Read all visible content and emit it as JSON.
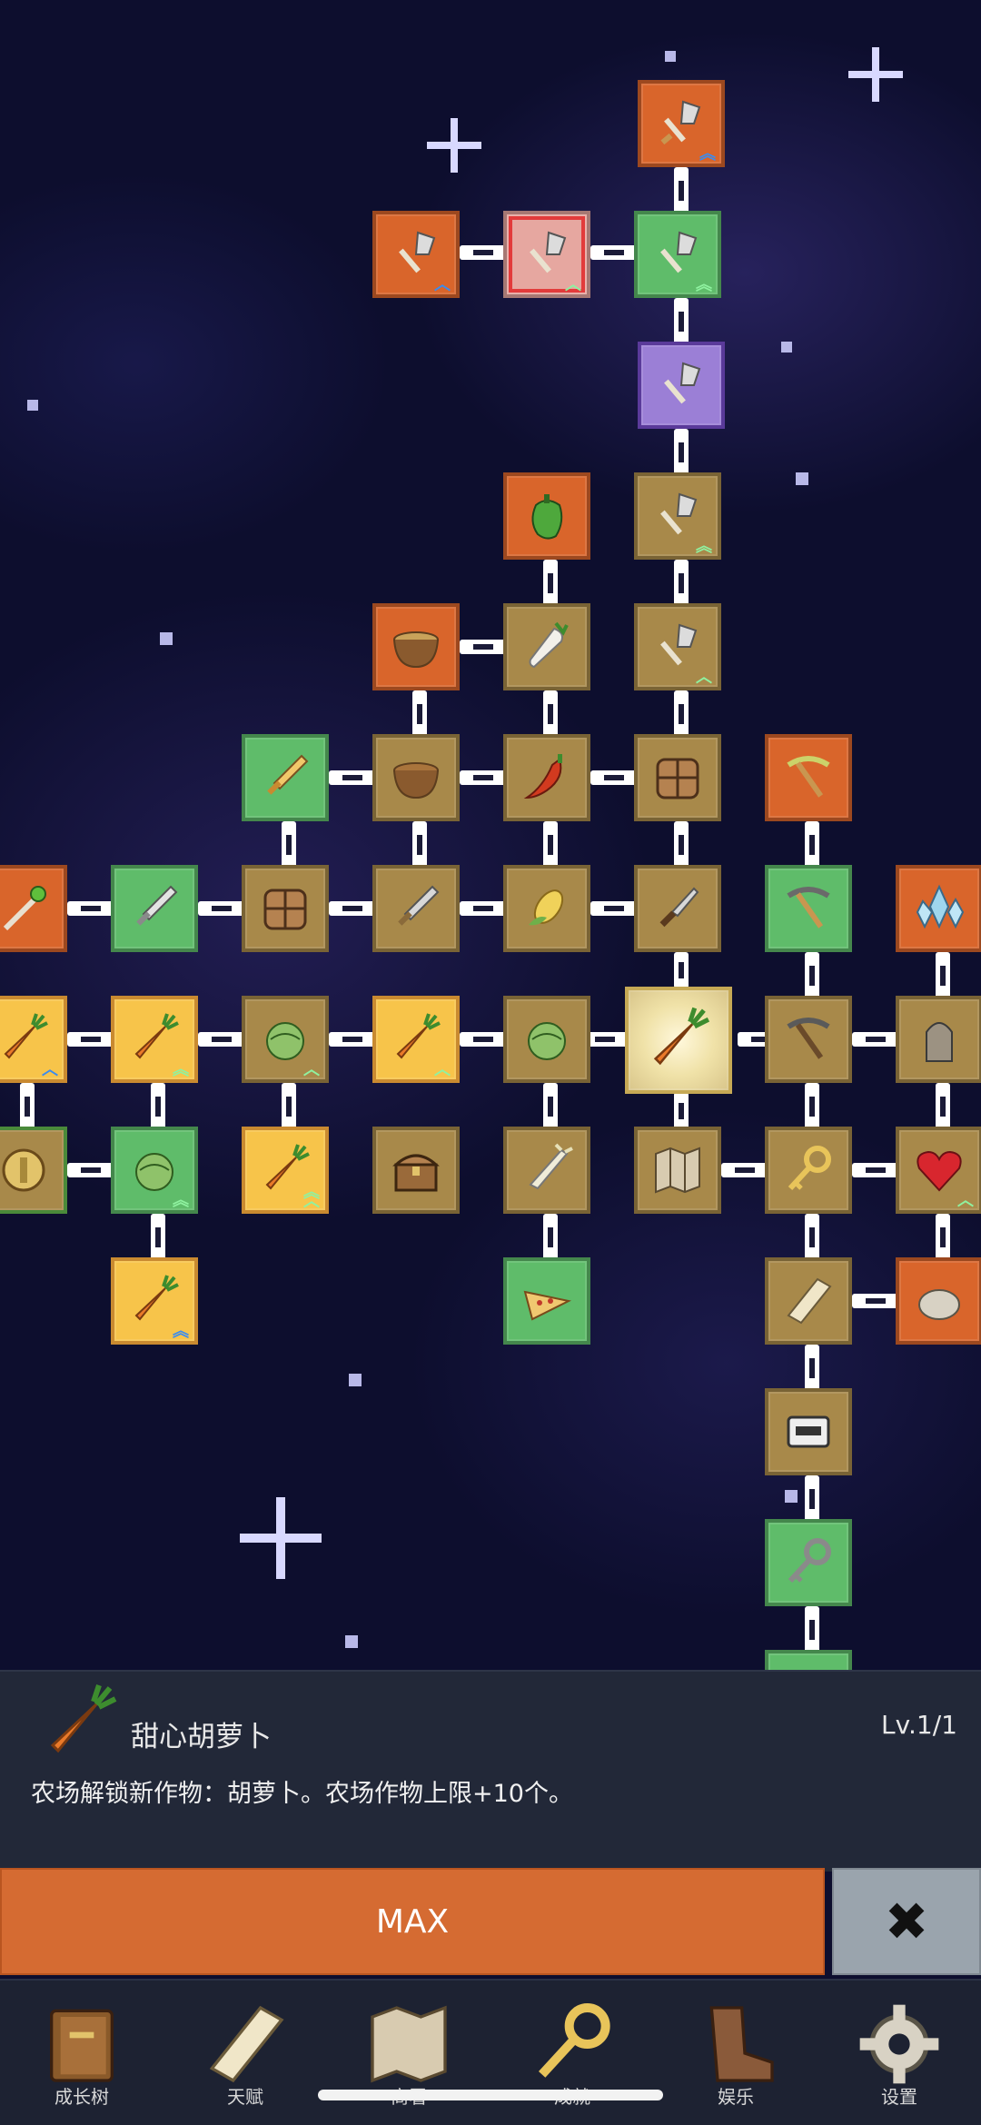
{
  "selected_skill": {
    "name": "甜心胡萝卜",
    "level": "Lv.1/1",
    "description": "农场解锁新作物：胡萝卜。农场作物上限+10个。",
    "icon": "carrot-icon"
  },
  "action_button": {
    "label": "MAX"
  },
  "close_button": {
    "icon": "close-icon",
    "glyph": "✖"
  },
  "nav": {
    "items": [
      {
        "label": "成长树",
        "icon": "book-icon"
      },
      {
        "label": "天赋",
        "icon": "scroll-icon"
      },
      {
        "label": "商署",
        "icon": "map-icon"
      },
      {
        "label": "成就",
        "icon": "key-icon"
      },
      {
        "label": "娱乐",
        "icon": "boot-icon"
      },
      {
        "label": "设置",
        "icon": "gear-icon"
      }
    ]
  },
  "tree_nodes": [
    {
      "icon": "shovel-icon",
      "color": "#d9652b",
      "upgrade": "double-blue"
    },
    {
      "icon": "shovel-icon",
      "color": "#d9652b",
      "upgrade": "single-blue"
    },
    {
      "icon": "shovel-icon",
      "color": "#5fbc6a",
      "upgrade": "single-green",
      "state": "selected-red"
    },
    {
      "icon": "shovel-icon",
      "color": "#5fbc6a",
      "upgrade": "double-green"
    },
    {
      "icon": "shovel-icon",
      "color": "#9b7fd6",
      "upgrade": "none"
    },
    {
      "icon": "pepper-icon",
      "color": "#d9652b"
    },
    {
      "icon": "shovel-icon",
      "color": "#a8894a",
      "upgrade": "double-green"
    },
    {
      "icon": "bowl-icon",
      "color": "#d9652b"
    },
    {
      "icon": "radish-icon",
      "color": "#a8894a"
    },
    {
      "icon": "shovel-icon",
      "color": "#a8894a",
      "upgrade": "single-green"
    },
    {
      "icon": "sword-icon",
      "color": "#5fbc6a"
    },
    {
      "icon": "bowl-icon",
      "color": "#a8894a"
    },
    {
      "icon": "chili-icon",
      "color": "#a8894a"
    },
    {
      "icon": "crate-icon",
      "color": "#a8894a"
    },
    {
      "icon": "pickaxe-icon",
      "color": "#d9652b"
    },
    {
      "icon": "wand-icon",
      "color": "#d9652b"
    },
    {
      "icon": "sword-icon",
      "color": "#5fbc6a"
    },
    {
      "icon": "crate-icon",
      "color": "#a8894a"
    },
    {
      "icon": "sword-icon",
      "color": "#a8894a"
    },
    {
      "icon": "corn-icon",
      "color": "#a8894a"
    },
    {
      "icon": "knife-icon",
      "color": "#a8894a"
    },
    {
      "icon": "pickaxe-icon",
      "color": "#5fbc6a"
    },
    {
      "icon": "crystal-icon",
      "color": "#d9652b"
    },
    {
      "icon": "carrot-icon",
      "color": "#f7c44a",
      "upgrade": "single-blue"
    },
    {
      "icon": "carrot-icon",
      "color": "#f7c44a",
      "upgrade": "double-green"
    },
    {
      "icon": "cabbage-icon",
      "color": "#a8894a",
      "upgrade": "single-green"
    },
    {
      "icon": "carrot-icon",
      "color": "#f7c44a",
      "upgrade": "single-green"
    },
    {
      "icon": "cabbage-icon",
      "color": "#a8894a"
    },
    {
      "icon": "carrot-icon",
      "color": "#f0e2a8",
      "state": "current"
    },
    {
      "icon": "pickaxe-icon",
      "color": "#a8894a"
    },
    {
      "icon": "statue-icon",
      "color": "#a8894a"
    },
    {
      "icon": "coin-icon",
      "color": "#a8894a"
    },
    {
      "icon": "cabbage-icon",
      "color": "#5fbc6a",
      "upgrade": "double-green"
    },
    {
      "icon": "carrot-icon",
      "color": "#f7c44a",
      "upgrade": "triple-green"
    },
    {
      "icon": "chest-icon",
      "color": "#a8894a"
    },
    {
      "icon": "leek-icon",
      "color": "#a8894a"
    },
    {
      "icon": "map-icon",
      "color": "#a8894a"
    },
    {
      "icon": "key-icon",
      "color": "#a8894a"
    },
    {
      "icon": "heart-icon",
      "color": "#a8894a",
      "upgrade": "single-green"
    },
    {
      "icon": "carrot-icon",
      "color": "#f7c44a",
      "upgrade": "double-blue"
    },
    {
      "icon": "pizza-icon",
      "color": "#5fbc6a"
    },
    {
      "icon": "scroll-icon",
      "color": "#a8894a"
    },
    {
      "icon": "stone-icon",
      "color": "#d9652b"
    },
    {
      "icon": "cassette-icon",
      "color": "#a8894a"
    },
    {
      "icon": "key-icon",
      "color": "#5fbc6a"
    },
    {
      "icon": "glove-icon",
      "color": "#5fbc6a"
    }
  ]
}
